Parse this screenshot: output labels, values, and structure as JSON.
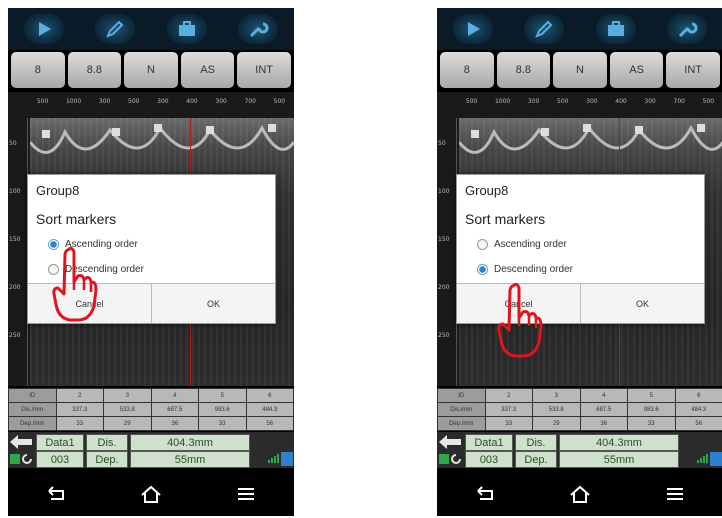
{
  "toolbar": {
    "icons": [
      "play-icon",
      "pen-icon",
      "briefcase-icon",
      "wrench-icon"
    ]
  },
  "mode_buttons": [
    "8",
    "8.8",
    "N",
    "AS",
    "INT"
  ],
  "ruler": {
    "top_ticks": [
      "500",
      "1000",
      "300",
      "500",
      "300",
      "400",
      "300",
      "700",
      "500"
    ],
    "depth_ticks": [
      "50",
      "100",
      "150",
      "200",
      "250"
    ]
  },
  "dialog": {
    "title": "Group8",
    "subtitle": "Sort markers",
    "option_ascending": "Ascending order",
    "option_descending": "Descending order",
    "cancel": "Cancel",
    "ok": "OK"
  },
  "left_screen": {
    "selected_option": "ascending"
  },
  "right_screen": {
    "selected_option": "descending"
  },
  "table": {
    "headers": [
      "ID",
      "Dis./mm",
      "Dep./mm"
    ],
    "columns": [
      {
        "id": "2",
        "dis": "337.3",
        "dep": "33"
      },
      {
        "id": "3",
        "dis": "533.8",
        "dep": "29"
      },
      {
        "id": "4",
        "dis": "687.5",
        "dep": "36"
      },
      {
        "id": "5",
        "dis": "983.6",
        "dep": "33"
      },
      {
        "id": "6",
        "dis": "484.3",
        "dep": "56"
      }
    ]
  },
  "status": {
    "data_label": "Data1",
    "file_no": "003",
    "dis_label": "Dis.",
    "dep_label": "Dep.",
    "dis_value": "404.3mm",
    "dep_value": "55mm"
  },
  "colors": {
    "accent_blue": "#2f7fd0",
    "cursor_red": "#b02020",
    "hand_red": "#e0141e",
    "status_green": "#2ea84a"
  }
}
